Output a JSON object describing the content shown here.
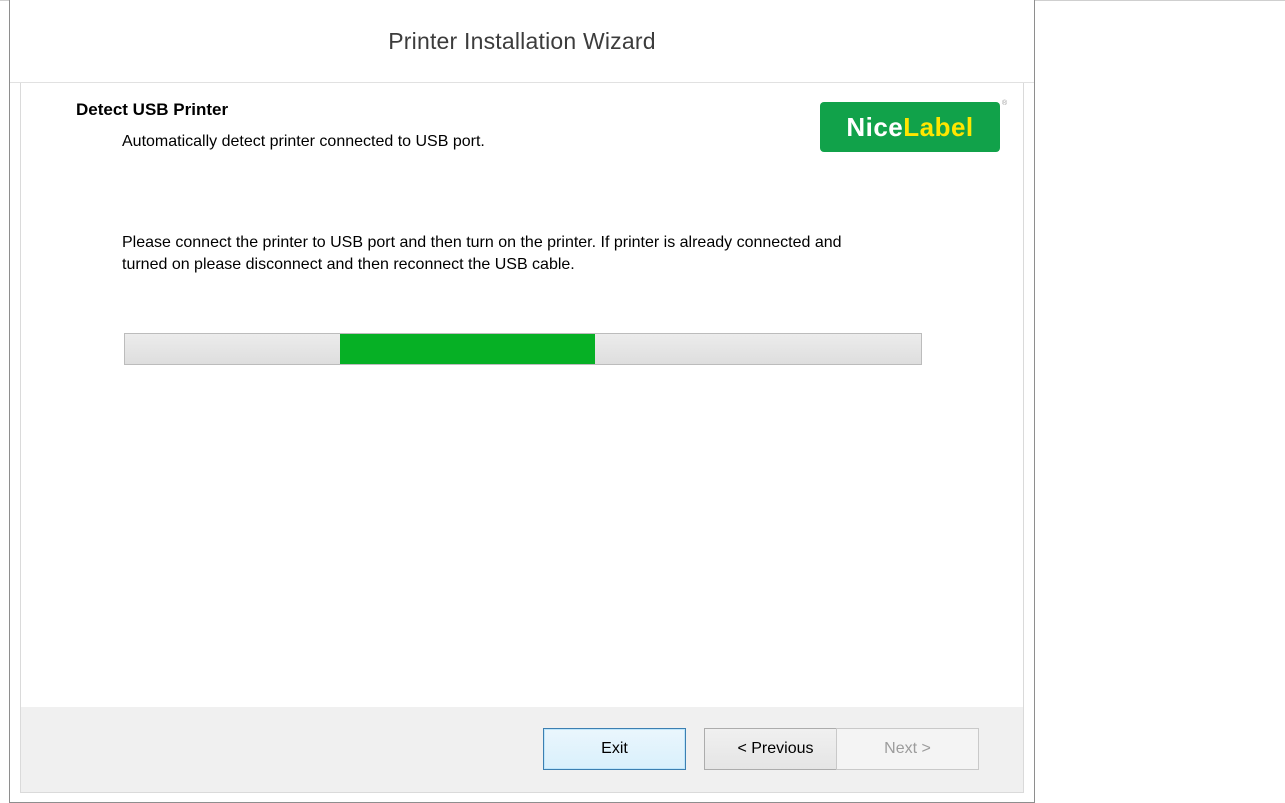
{
  "window": {
    "title": "Printer Installation Wizard"
  },
  "step": {
    "title": "Detect USB Printer",
    "subtitle": "Automatically detect printer connected to USB port."
  },
  "logo": {
    "part1": "Nice",
    "part2": "Label",
    "mark": "®",
    "colors": {
      "background": "#11a24a",
      "part1": "#ffffff",
      "part2": "#ffe600"
    }
  },
  "instruction": "Please connect the printer to USB port and then turn on the printer. If printer is already connected and turned on please disconnect and then reconnect the USB cable.",
  "progress": {
    "mode": "marquee",
    "segment_start": 0.27,
    "segment_end": 0.59,
    "color": "#06b025"
  },
  "buttons": {
    "exit": "Exit",
    "previous": "< Previous",
    "next": "Next >"
  }
}
